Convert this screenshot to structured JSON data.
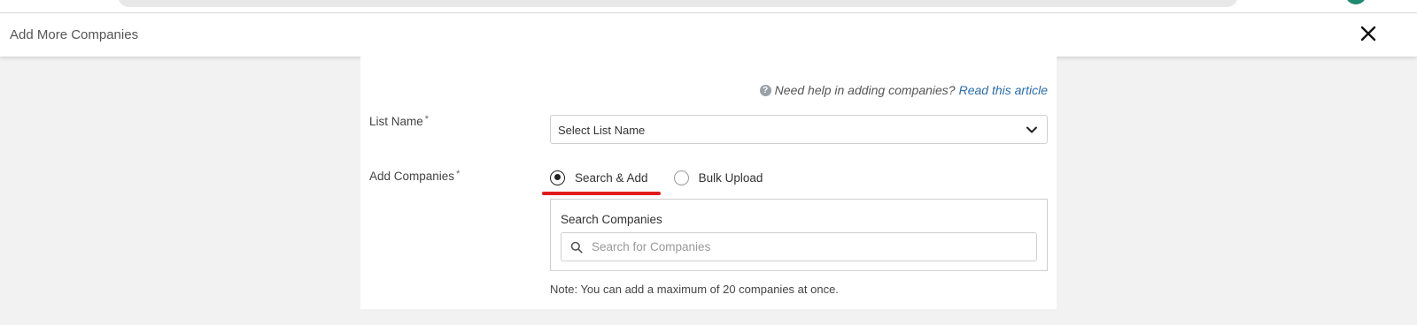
{
  "modal": {
    "title": "Add More Companies"
  },
  "help": {
    "text": "Need help in adding companies?",
    "link_text": "Read this article"
  },
  "list_name": {
    "label": "List Name",
    "required_mark": "*",
    "selected": "Select List Name"
  },
  "add_companies": {
    "label": "Add Companies",
    "required_mark": "*",
    "options": [
      {
        "label": "Search & Add",
        "checked": true
      },
      {
        "label": "Bulk Upload",
        "checked": false
      }
    ],
    "highlight_color": "#e01b1b"
  },
  "search": {
    "label": "Search Companies",
    "placeholder": "Search for Companies",
    "value": ""
  },
  "note": "Note: You can add a maximum of 20 companies at once.",
  "colors": {
    "link": "#2a6db0",
    "background": "#f2f2f2",
    "avatar": "#1f8a70"
  }
}
